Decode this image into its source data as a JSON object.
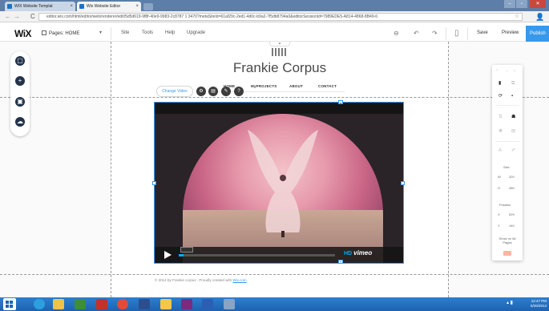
{
  "browser": {
    "tabs": [
      {
        "title": "WIX Website Templat"
      },
      {
        "title": "Wix Website Editor"
      }
    ],
    "url": "editor.wix.com/html/editor/web/renderer/edit/5d5d619-9f8f-40e9-9983-2c8787 1 3470?metaSiteId=61af29c-2ed1-4d0c-b9a2-7f5db8794a0&editorSessionId=7989EDE5-A814-4868-8B49-6"
  },
  "editor": {
    "logo": "WiX",
    "page_selector": "Pages: HOME",
    "menus": [
      "Site",
      "Tools",
      "Help",
      "Upgrade"
    ],
    "save_label": "Save",
    "preview_label": "Preview",
    "publish_label": "Publish"
  },
  "site": {
    "title": "Frankie Corpus",
    "nav": [
      "HOME",
      "MyPROJECTS",
      "ABOUT",
      "CONTACT"
    ],
    "footer": "© 2014 by Frankie corpus . Proudly created with",
    "footer_link": "Wix.com"
  },
  "video_toolbar": {
    "change_video_label": "Change Video"
  },
  "video": {
    "progress": 0.03,
    "hd_label": "HD",
    "brand_label": "vimeo"
  },
  "inspector": {
    "size_heading": "Size",
    "width_label": "W",
    "width_value": "320",
    "height_label": "H",
    "height_value": "480",
    "position_heading": "Position",
    "x_label": "X",
    "x_value": "529",
    "y_label": "Y",
    "y_value": "140",
    "show_all_pages": "Show on All Pages"
  },
  "taskbar": {
    "clock_time": "12:47 PM",
    "clock_date": "5/26/2014"
  },
  "colors": {
    "accent": "#3899ec",
    "publish": "#3899ec",
    "taskbar": "#1f62b0"
  }
}
